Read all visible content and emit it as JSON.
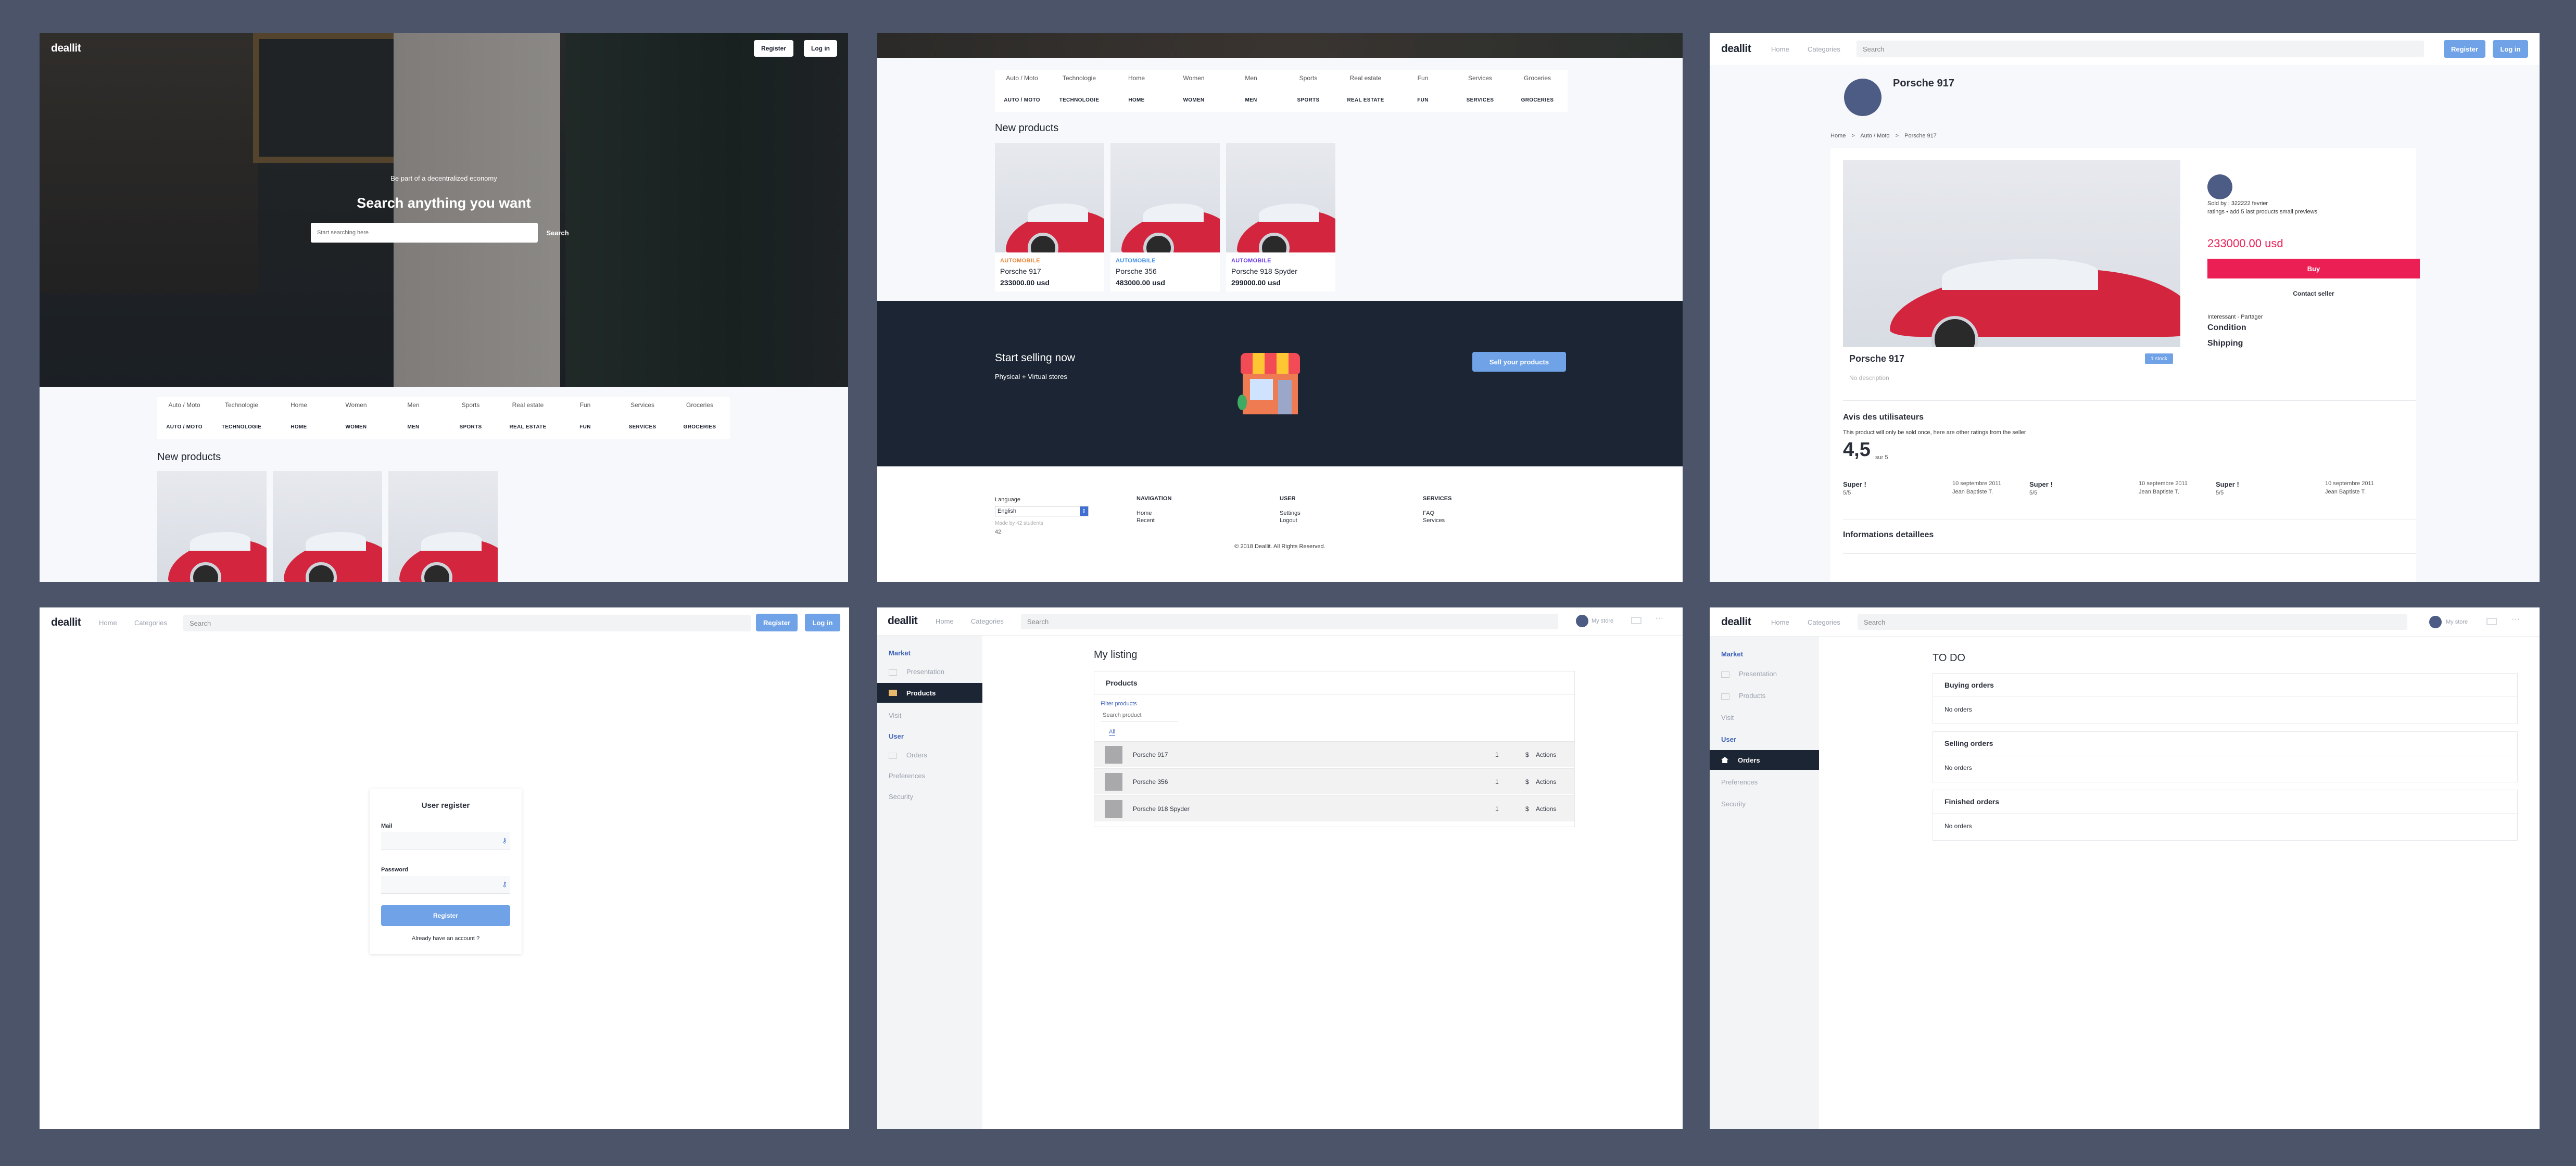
{
  "brand": "deallit",
  "nav": {
    "home": "Home",
    "categories": "Categories",
    "search_placeholder": "Search",
    "register": "Register",
    "login": "Log in",
    "mystore": "My store"
  },
  "hero": {
    "tagline": "Be part of a decentralized economy",
    "title": "Search anything you want",
    "search_placeholder": "Start searching here",
    "search_button": "Search"
  },
  "categories": [
    {
      "img": "Auto / Moto",
      "label": "AUTO / MOTO"
    },
    {
      "img": "Technologie",
      "label": "TECHNOLOGIE"
    },
    {
      "img": "Home",
      "label": "HOME"
    },
    {
      "img": "Women",
      "label": "WOMEN"
    },
    {
      "img": "Men",
      "label": "MEN"
    },
    {
      "img": "Sports",
      "label": "SPORTS"
    },
    {
      "img": "Real estate",
      "label": "REAL ESTATE"
    },
    {
      "img": "Fun",
      "label": "FUN"
    },
    {
      "img": "Services",
      "label": "SERVICES"
    },
    {
      "img": "Groceries",
      "label": "GROCERIES"
    }
  ],
  "new_products_title": "New products",
  "products": [
    {
      "tag": "AUTOMOBILE",
      "tag_color": "#e8883a",
      "name": "Porsche 917",
      "price": "233000.00 usd"
    },
    {
      "tag": "AUTOMOBILE",
      "tag_color": "#3a8ee8",
      "name": "Porsche 356",
      "price": "483000.00 usd"
    },
    {
      "tag": "AUTOMOBILE",
      "tag_color": "#6a3ae8",
      "name": "Porsche 918 Spyder",
      "price": "299000.00 usd"
    }
  ],
  "sell": {
    "title": "Start selling now",
    "subtitle": "Physical + Virtual stores",
    "button": "Sell your products"
  },
  "footer": {
    "language_label": "Language",
    "language_value": "English",
    "made_by": "Made by 42 students",
    "logo_alt": "42",
    "nav_title": "NAVIGATION",
    "nav_items": [
      "Home",
      "Recent"
    ],
    "user_title": "USER",
    "user_items": [
      "Settings",
      "Logout"
    ],
    "services_title": "SERVICES",
    "services_items": [
      "FAQ",
      "Services"
    ],
    "copyright": "© 2018 Deallit. All Rights Reserved."
  },
  "product_page": {
    "title": "Porsche 917",
    "breadcrumb": [
      "Home",
      "Auto / Moto",
      "Porsche 917"
    ],
    "seller_line": "Sold by :  322222 fevrier",
    "seller_sub": "ratings • add 5 last products small previews",
    "price": "233000.00 usd",
    "buy": "Buy",
    "contact": "Contact seller",
    "meta": "Interessant - Partager",
    "condition": "Condition",
    "shipping": "Shipping",
    "card_title": "Porsche 917",
    "card_badge": "1 stock",
    "card_desc": "No description",
    "reviews_title": "Avis des utilisateurs",
    "reviews_sub": "This product will only be sold once, here are other ratings from the seller",
    "rating": "4,5",
    "rating_suffix": "sur 5",
    "reviews": [
      {
        "title": "Super !",
        "score": "5/5",
        "date": "10 septembre 2011",
        "author": "Jean Baptiste T."
      },
      {
        "title": "Super !",
        "score": "5/5",
        "date": "10 septembre 2011",
        "author": "Jean Baptiste T."
      },
      {
        "title": "Super !",
        "score": "5/5",
        "date": "10 septembre 2011",
        "author": "Jean Baptiste T."
      }
    ],
    "details_title": "Informations detaillees"
  },
  "register": {
    "title": "User register",
    "mail_label": "Mail",
    "password_label": "Password",
    "button": "Register",
    "login_link": "Already have an account ?"
  },
  "sidebar": {
    "market": "Market",
    "presentation": "Presentation",
    "products": "Products",
    "visit": "Visit",
    "user": "User",
    "orders": "Orders",
    "preferences": "Preferences",
    "security": "Security"
  },
  "listing": {
    "title": "My listing",
    "box_title": "Products",
    "filter_label": "Filter products",
    "filter_placeholder": "Search product",
    "tab_all": "All",
    "rows": [
      {
        "name": "Porsche 917",
        "qty": "1",
        "currency": "$",
        "actions": "Actions"
      },
      {
        "name": "Porsche 356",
        "qty": "1",
        "currency": "$",
        "actions": "Actions"
      },
      {
        "name": "Porsche 918 Spyder",
        "qty": "1",
        "currency": "$",
        "actions": "Actions"
      }
    ]
  },
  "todo": {
    "title": "TO DO",
    "sections": [
      {
        "title": "Buying orders",
        "empty": "No orders"
      },
      {
        "title": "Selling orders",
        "empty": "No orders"
      },
      {
        "title": "Finished orders",
        "empty": "No orders"
      }
    ]
  }
}
